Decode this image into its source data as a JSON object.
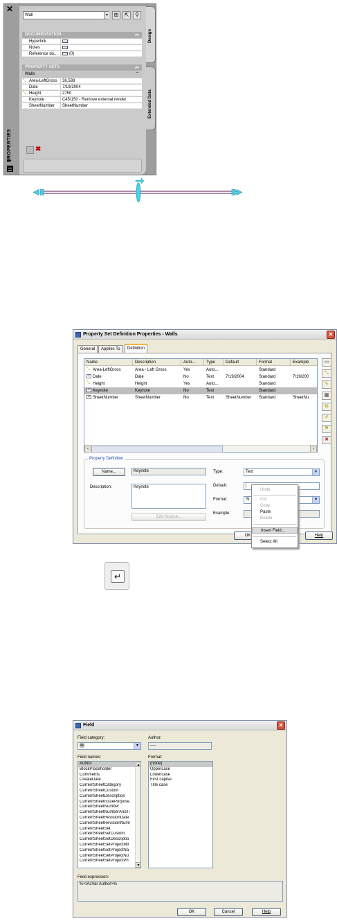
{
  "palette": {
    "title": "PROPERTIES",
    "style_value": "Wall",
    "tab_design": "Design",
    "tab_extended": "Extended Data",
    "documentation_header": "DOCUMENTATION",
    "documentation_rows": [
      {
        "key": "Hyperlink",
        "value": ""
      },
      {
        "key": "Notes",
        "value": ""
      },
      {
        "key": "Reference do...",
        "value": "(0)"
      }
    ],
    "propsets_header": "PROPERTY SETS",
    "propsets_sub": "Walls",
    "propset_rows": [
      {
        "key": "Area-LeftGross",
        "value": "36,588"
      },
      {
        "key": "Date",
        "value": "7/19/2004"
      },
      {
        "key": "Height",
        "value": "2750"
      },
      {
        "key": "Keynote",
        "value": "C45/150 - Remove external render"
      },
      {
        "key": "SheetNumber",
        "value": "SheetNumber"
      }
    ]
  },
  "dialog1": {
    "title": "Property Set Definition Properties - Walls",
    "tabs": [
      "General",
      "Applies To",
      "Definition"
    ],
    "columns": [
      "Name",
      "Description",
      "Auto...",
      "Type",
      "Default",
      "Format",
      "Example"
    ],
    "rows": [
      {
        "icon": "auto-icon",
        "cells": [
          "Area-LeftGross",
          "Area - Left Gross",
          "Yes",
          "Auto...",
          "",
          "Standard",
          ""
        ]
      },
      {
        "icon": "box-icon",
        "cells": [
          "Date",
          "Date",
          "No",
          "Text",
          "7/19/2004",
          "Standard",
          "7/19/200"
        ]
      },
      {
        "icon": "auto-icon",
        "cells": [
          "Height",
          "Height",
          "Yes",
          "Auto...",
          "",
          "Standard",
          ""
        ]
      },
      {
        "icon": "none",
        "cells": [
          "Keynote",
          "Keynote",
          "No",
          "Text",
          "",
          "Standard",
          ""
        ]
      },
      {
        "icon": "box-icon",
        "cells": [
          "SheetNumber",
          "SheetNumber",
          "No",
          "Text",
          "SheetNumber",
          "Standard",
          "SheetNu"
        ]
      }
    ],
    "group_label": "Property Definition",
    "name_button": "Name...",
    "name_value": "Keynote",
    "description_label": "Description:",
    "description_value": "Keynote",
    "edit_source_button": "Edit Source...",
    "type_label": "Type:",
    "type_value": "Text",
    "default_label": "Default:",
    "format_label": "Format:",
    "format_value": "St",
    "example_label": "Example:",
    "ok_button": "OK",
    "help_button": "Help"
  },
  "context_menu": {
    "items": [
      "Undo",
      "Cut",
      "Copy",
      "Paste",
      "Delete",
      "Insert Field...",
      "Select All"
    ]
  },
  "enter_key": {
    "glyph": "↵"
  },
  "dialog2": {
    "title": "Field",
    "category_label": "Field category:",
    "category_value": "All",
    "author_label": "Author:",
    "author_value": "----",
    "names_label": "Field names:",
    "field_names": [
      "Author",
      "BlockPlaceholder",
      "Comments",
      "CreateDate",
      "CurrentSheetCategory",
      "CurrentSheetCustom",
      "CurrentSheetDescription",
      "CurrentSheetIssuePurpose",
      "CurrentSheetNumber",
      "CurrentSheetNumberAndTi",
      "CurrentSheetRevisionDate",
      "CurrentSheetRevisionNuml",
      "CurrentSheetSet",
      "CurrentSheetSetCustom",
      "CurrentSheetSetDescriptio",
      "CurrentSheetSetProjectMil",
      "CurrentSheetSetProjectNa",
      "CurrentSheetSetProjectNu",
      "CurrentSheetSetProjectPh"
    ],
    "format_label": "Format:",
    "formats": [
      "(none)",
      "Uppercase",
      "Lowercase",
      "First capital",
      "Title case"
    ],
    "expression_label": "Field expression:",
    "expression_value": "%<\\AcVar Author>%",
    "ok_button": "OK",
    "cancel_button": "Cancel",
    "help_button": "Help"
  }
}
